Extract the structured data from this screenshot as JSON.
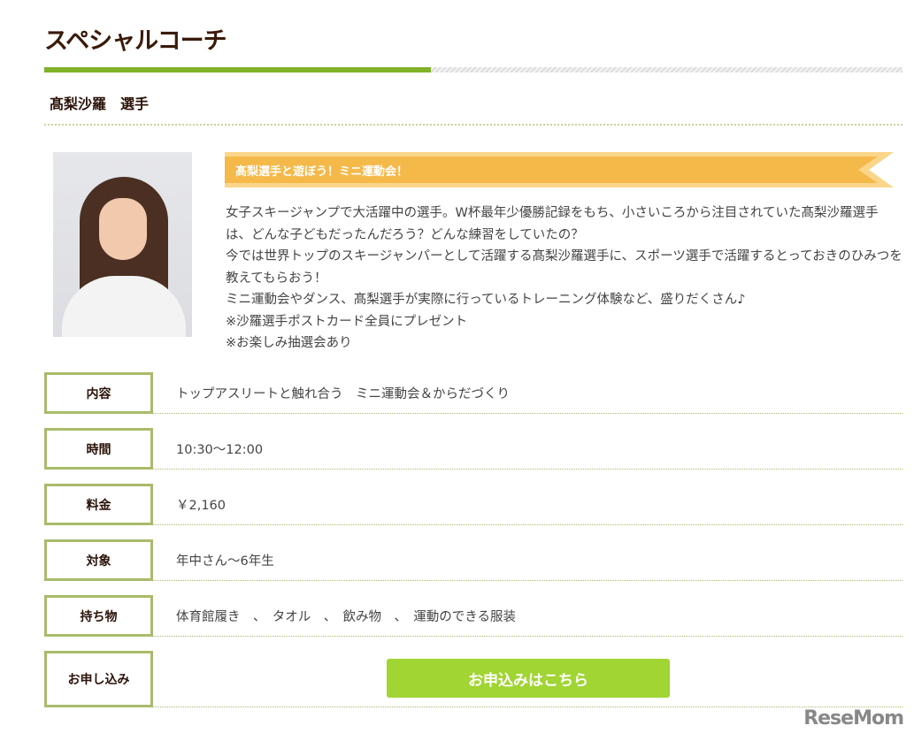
{
  "title": "スペシャルコーチ",
  "progress_percent": 45,
  "coach_name": "髙梨沙羅　選手",
  "banner": "髙梨選手と遊ぼう！ミニ運動会！",
  "description": [
    "女子スキージャンプで大活躍中の選手。W杯最年少優勝記録をもち、小さいころから注目されていた髙梨沙羅選手は、どんな子どもだったんだろう？どんな練習をしていたの？",
    "今では世界トップのスキージャンパーとして活躍する髙梨沙羅選手に、スポーツ選手で活躍するとっておきのひみつを教えてもらおう！",
    "ミニ運動会やダンス、髙梨選手が実際に行っているトレーニング体験など、盛りだくさん♪",
    "※沙羅選手ポストカード全員にプレゼント",
    "※お楽しみ抽選会あり"
  ],
  "rows": [
    {
      "label": "内容",
      "value": "トップアスリートと触れ合う　ミニ運動会＆からだづくり"
    },
    {
      "label": "時間",
      "value": "10:30〜12:00"
    },
    {
      "label": "料金",
      "value": "￥2,160"
    },
    {
      "label": "対象",
      "value": "年中さん〜6年生"
    },
    {
      "label": "持ち物",
      "value": "体育館履き　、　タオル　、　飲み物　、　運動のできる服装"
    },
    {
      "label": "お申し込み",
      "button": "お申込みはこちら"
    }
  ],
  "watermark": "ReseMom",
  "colors": {
    "accent_green": "#80b228",
    "button": "#a0d533",
    "banner": "#f5b94a",
    "border": "#a9bb6a"
  }
}
